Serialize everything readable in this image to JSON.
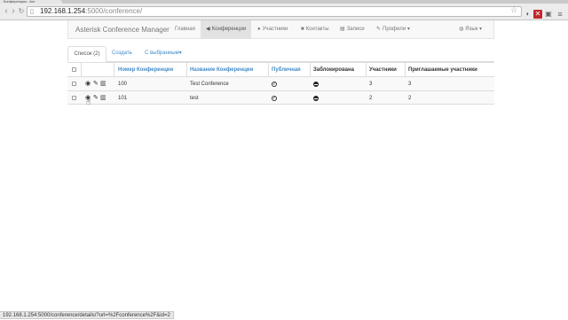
{
  "browser": {
    "tab_title": "Конференции - Аст",
    "url_host": "192.168.1.254",
    "url_rest": ":5000/conference/",
    "status_url": "192.168.1.254:5000/conference/details/?url=%2Fconference%2F&id=2"
  },
  "navbar": {
    "brand": "Asterisk Conference Manager",
    "items": [
      {
        "label": "Главная",
        "icon": ""
      },
      {
        "label": "Конференции",
        "icon": "megaphone-icon"
      },
      {
        "label": "Участники",
        "icon": "user-icon"
      },
      {
        "label": "Контакты",
        "icon": "book-icon"
      },
      {
        "label": "Записи",
        "icon": "film-icon"
      },
      {
        "label": "Профили",
        "icon": "wrench-icon"
      }
    ],
    "language": "Язык"
  },
  "tabs": {
    "list": "Список (2)",
    "create": "Создать",
    "with_selected": "С выбранным"
  },
  "table": {
    "headers": [
      "Номер Конференции",
      "Название Конференции",
      "Публичная",
      "Заблокирована",
      "Участники",
      "Приглашаемые участники"
    ],
    "rows": [
      {
        "number": "100",
        "name": "Test Conference",
        "public": true,
        "locked": true,
        "participants": "3",
        "invited": "3"
      },
      {
        "number": "101",
        "name": "test",
        "public": true,
        "locked": true,
        "participants": "2",
        "invited": "2"
      }
    ]
  },
  "colors": {
    "link": "#428bca",
    "navbar_bg": "#f8f8f8",
    "active_nav": "#e2e2e2"
  }
}
